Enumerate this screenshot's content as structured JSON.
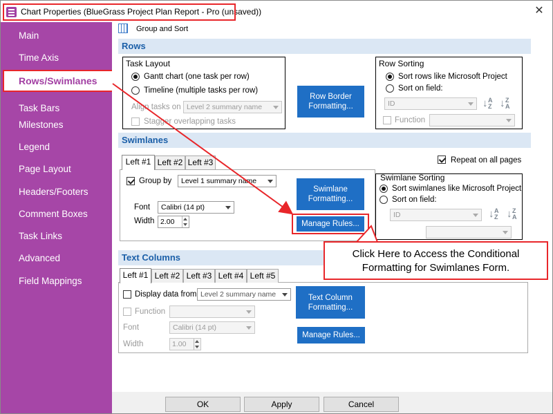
{
  "window": {
    "title": "Chart Properties (BlueGrass Project Plan Report - Pro (unsaved))",
    "close_glyph": "✕"
  },
  "sidebar": {
    "items": [
      {
        "label": "Main"
      },
      {
        "label": "Time Axis"
      },
      {
        "label": "Rows/Swimlanes",
        "selected": true
      },
      {
        "label": "Task Bars"
      },
      {
        "label": "Milestones"
      },
      {
        "label": "Legend"
      },
      {
        "label": "Page Layout"
      },
      {
        "label": "Headers/Footers"
      },
      {
        "label": "Comment Boxes"
      },
      {
        "label": "Task Links"
      },
      {
        "label": "Advanced"
      },
      {
        "label": "Field Mappings"
      }
    ]
  },
  "toolbar": {
    "group_sort_label": "Group and Sort"
  },
  "rows": {
    "section_title": "Rows",
    "task_layout": {
      "title": "Task Layout",
      "gantt_label": "Gantt chart (one task per row)",
      "timeline_label": "Timeline (multiple tasks per row)",
      "align_label": "Align tasks on",
      "align_value": "Level 2 summary name",
      "stagger_label": "Stagger overlapping tasks"
    },
    "row_border_button": "Row Border\nFormatting...",
    "row_sorting": {
      "title": "Row Sorting",
      "sort_ms_label": "Sort rows like Microsoft Project",
      "sort_field_label": "Sort on field:",
      "field_value": "ID",
      "function_label": "Function",
      "function_value": ""
    }
  },
  "swimlanes": {
    "section_title": "Swimlanes",
    "tabs": [
      "Left #1",
      "Left #2",
      "Left #3"
    ],
    "repeat_label": "Repeat on all pages",
    "group_by_label": "Group by",
    "group_by_value": "Level 1 summary name",
    "font_label": "Font",
    "font_value": "Calibri (14 pt)",
    "width_label": "Width",
    "width_value": "2.00",
    "format_button": "Swimlane\nFormatting...",
    "manage_rules_button": "Manage Rules...",
    "sorting": {
      "title": "Swimlane Sorting",
      "sort_ms_label": "Sort swimlanes like Microsoft Project",
      "sort_field_label": "Sort on field:",
      "field_value": "ID",
      "function_value": ""
    }
  },
  "text_columns": {
    "section_title": "Text Columns",
    "tabs": [
      "Left #1",
      "Left #2",
      "Left #3",
      "Left #4",
      "Left #5"
    ],
    "display_label": "Display data from",
    "display_value": "Level 2 summary name",
    "function_label": "Function",
    "function_value": "",
    "font_label": "Font",
    "font_value": "Calibri (14 pt)",
    "width_label": "Width",
    "width_value": "1.00",
    "format_button": "Text Column\nFormatting...",
    "manage_rules_button": "Manage Rules..."
  },
  "callout": {
    "line1": "Click Here to Access the Conditional",
    "line2": "Formatting for Swimlanes Form."
  },
  "footer": {
    "ok": "OK",
    "apply": "Apply",
    "cancel": "Cancel"
  },
  "colors": {
    "sidebar": "#a646a7",
    "accent_blue": "#1f6fc5",
    "annotation_red": "#e8262a",
    "section_bg": "#dbe7f4"
  },
  "icons": {
    "app": "app-icon",
    "group_sort": "group-sort-icon",
    "sort_az": "sort-az-icon",
    "sort_za": "sort-za-icon"
  }
}
